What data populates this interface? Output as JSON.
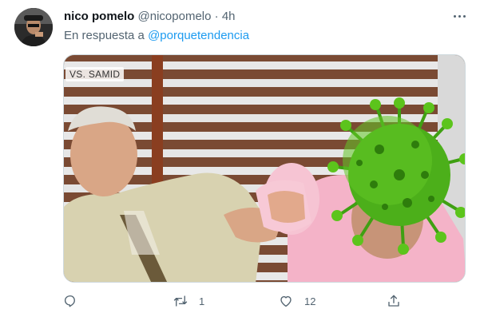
{
  "tweet": {
    "author_name": "nico pomelo",
    "author_handle": "@nicopomelo",
    "separator": "·",
    "time": "4h",
    "reply_prefix": "En respuesta a",
    "reply_to": "@porquetendencia",
    "media_watermark": "VS. SAMID",
    "actions": {
      "retweets": "1",
      "likes": "12"
    }
  },
  "colors": {
    "link": "#1d9bf0",
    "muted": "#536471",
    "virus": "#4caf1a"
  },
  "icons": [
    "avatar",
    "more-options-icon",
    "reply-icon",
    "retweet-icon",
    "like-icon",
    "share-icon"
  ]
}
